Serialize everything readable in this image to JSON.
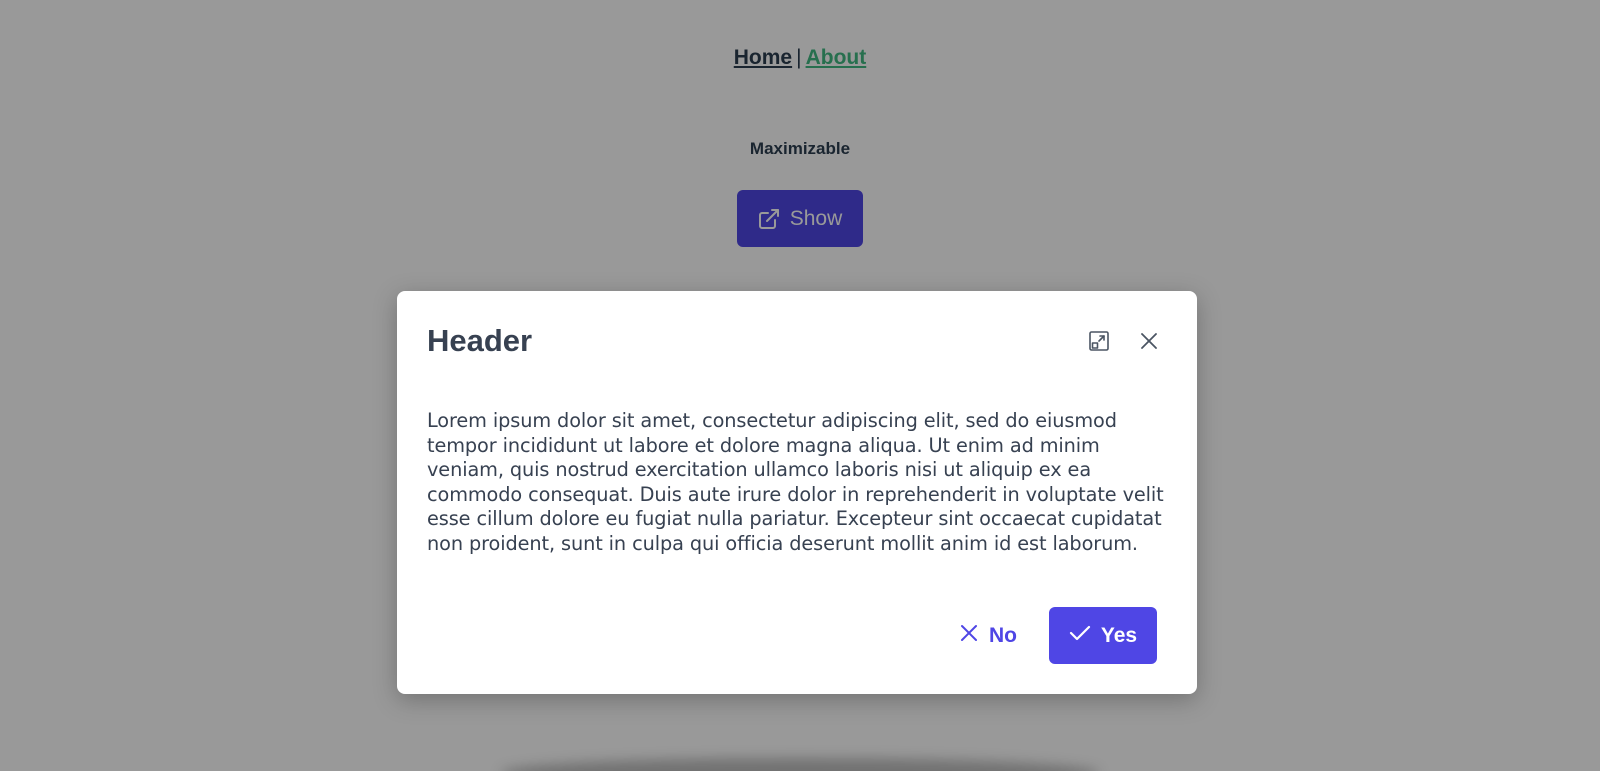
{
  "nav": {
    "home_label": "Home",
    "separator": "|",
    "about_label": "About"
  },
  "section": {
    "title": "Maximizable"
  },
  "show_button": {
    "label": "Show",
    "icon": "external-link-icon"
  },
  "dialog": {
    "title": "Header",
    "maximize_icon": "window-maximize-icon",
    "close_icon": "close-icon",
    "body": "Lorem ipsum dolor sit amet, consectetur adipiscing elit, sed do eiusmod tempor incididunt ut labore et dolore magna aliqua. Ut enim ad minim veniam, quis nostrud exercitation ullamco laboris nisi ut aliquip ex ea commodo consequat. Duis aute irure dolor in reprehenderit in voluptate velit esse cillum dolore eu fugiat nulla pariatur. Excepteur sint occaecat cupidatat non proident, sunt in culpa qui officia deserunt mollit anim id est laborum.",
    "no_label": "No",
    "yes_label": "Yes"
  },
  "colors": {
    "primary": "#4f46e5",
    "nav_link": "#2c3e50",
    "nav_active": "#42b983",
    "text": "#374151"
  }
}
